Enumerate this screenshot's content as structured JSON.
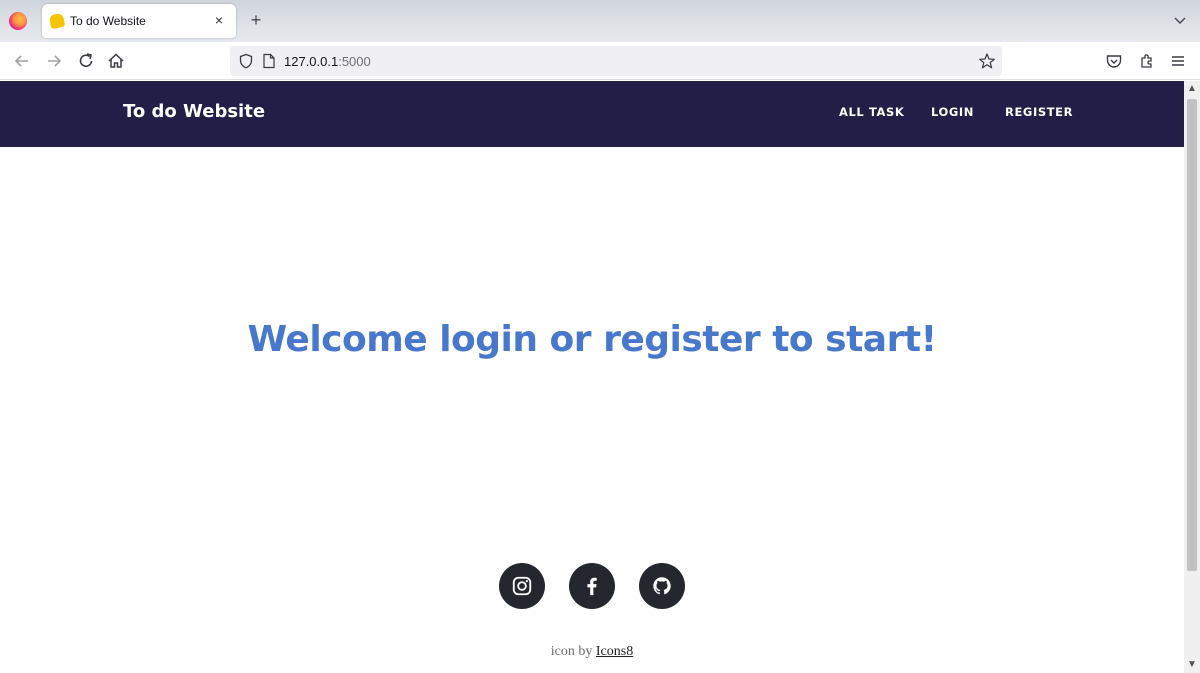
{
  "browser": {
    "tab_title": "To do Website",
    "tab_close": "×",
    "new_tab": "+",
    "url_host": "127.0.0.1",
    "url_port": ":5000"
  },
  "site": {
    "brand": "To do Website",
    "nav": {
      "all_task": "ALL TASK",
      "login": "LOGIN",
      "register": "REGISTER"
    },
    "hero_title": "Welcome login or register to start!",
    "social": [
      "instagram-icon",
      "facebook-icon",
      "github-icon"
    ],
    "credit_prefix": "icon by",
    "credit_link": "Icons8"
  },
  "colors": {
    "header_bg": "#221e48",
    "hero_text": "#4878cb",
    "social_bg": "#24282e"
  }
}
